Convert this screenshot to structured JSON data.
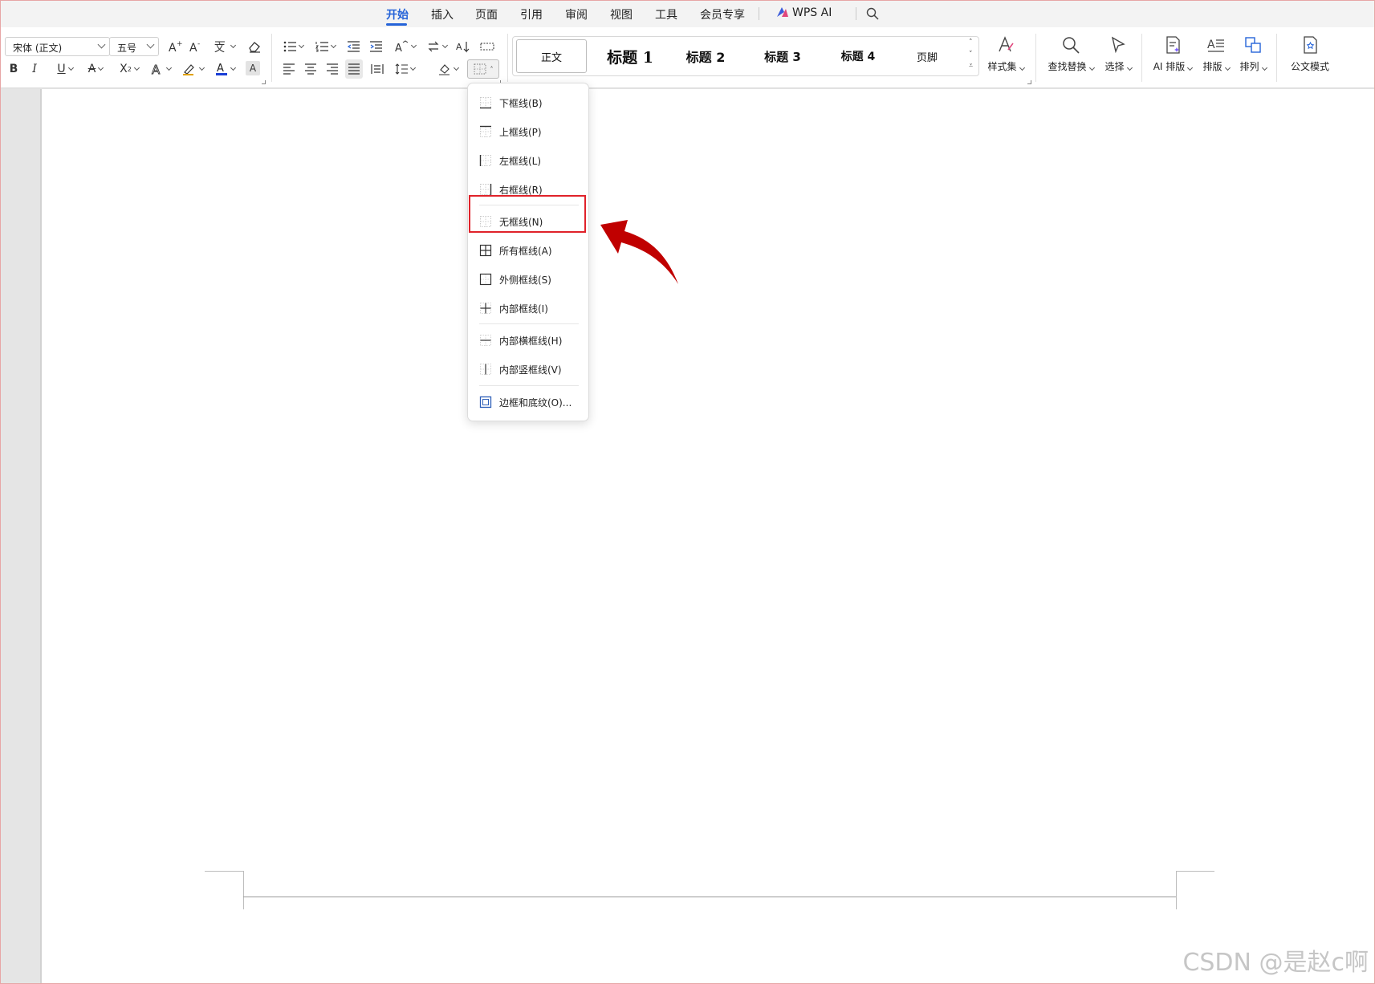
{
  "tabs": [
    "开始",
    "插入",
    "页面",
    "引用",
    "审阅",
    "视图",
    "工具",
    "会员专享"
  ],
  "active_tab": "开始",
  "wps_ai_label": "WPS AI",
  "font": {
    "name": "宋体 (正文)",
    "size": "五号"
  },
  "styles": [
    {
      "label": "正文",
      "cls": "si-normal"
    },
    {
      "label": "标题 1",
      "cls": "si-h1"
    },
    {
      "label": "标题 2",
      "cls": "si-h2"
    },
    {
      "label": "标题 3",
      "cls": "si-h3"
    },
    {
      "label": "标题 4",
      "cls": "si-h4"
    },
    {
      "label": "页脚",
      "cls": "si-foot"
    }
  ],
  "ribbon_buttons": {
    "style_set": "样式集",
    "find_replace": "查找替换",
    "select": "选择",
    "ai_layout": "AI 排版",
    "layout": "排版",
    "arrange": "排列",
    "official_format": "公文模式"
  },
  "border_menu": {
    "items": [
      {
        "label": "下框线(B)",
        "icon": "bottom-border-icon"
      },
      {
        "label": "上框线(P)",
        "icon": "top-border-icon"
      },
      {
        "label": "左框线(L)",
        "icon": "left-border-icon"
      },
      {
        "label": "右框线(R)",
        "icon": "right-border-icon"
      },
      {
        "label": "无框线(N)",
        "icon": "no-border-icon",
        "highlighted": true
      },
      {
        "label": "所有框线(A)",
        "icon": "all-borders-icon"
      },
      {
        "label": "外侧框线(S)",
        "icon": "outside-borders-icon"
      },
      {
        "label": "内部框线(I)",
        "icon": "inside-borders-icon"
      },
      {
        "label": "内部横框线(H)",
        "icon": "inside-horizontal-border-icon"
      },
      {
        "label": "内部竖框线(V)",
        "icon": "inside-vertical-border-icon"
      },
      {
        "label": "边框和底纹(O)...",
        "icon": "borders-and-shading-icon"
      }
    ]
  },
  "colors": {
    "accent": "#2563d8",
    "highlight_box": "#e0222a",
    "annotation_arrow": "#c00000",
    "font_color_bar": "#1a3fd6"
  },
  "watermark": "CSDN @是赵c啊"
}
